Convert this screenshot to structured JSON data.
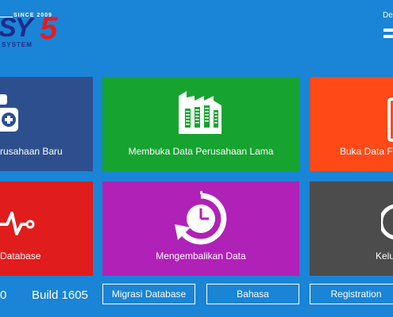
{
  "logo": {
    "since": "SINCE 2009",
    "letters": "SY",
    "digit": "5",
    "tagline": "SYSTEM"
  },
  "topright": {
    "label": "De"
  },
  "tiles": [
    {
      "label": "rusahaan Baru",
      "icon": "new-company-icon",
      "color": "#2d4f8e"
    },
    {
      "label": "Membuka Data Perusahaan Lama",
      "icon": "factory-icon",
      "color": "#17a330"
    },
    {
      "label": "Buka Data F",
      "icon": "document-icon",
      "color": "#ff4a17"
    },
    {
      "label": "Database",
      "icon": "heartbeat-icon",
      "color": "#e01c1c"
    },
    {
      "label": "Mengembalikan Data",
      "icon": "restore-clock-icon",
      "color": "#b021b7"
    },
    {
      "label": "Kelu",
      "icon": "power-icon",
      "color": "#4c4c4c"
    }
  ],
  "footer": {
    "version": "0",
    "build": "Build 1605",
    "buttons": [
      "Migrasi Database",
      "Bahasa",
      "Registration"
    ]
  }
}
